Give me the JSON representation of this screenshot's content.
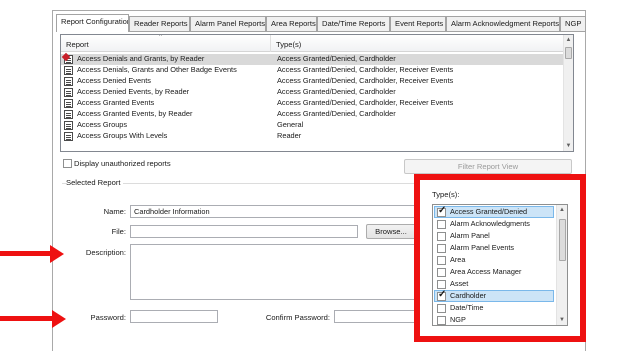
{
  "tabs": [
    "Report Configuration",
    "Reader Reports",
    "Alarm Panel Reports",
    "Area Reports",
    "Date/Time Reports",
    "Event Reports",
    "Alarm Acknowledgment Reports",
    "NGP"
  ],
  "report_list": {
    "columns": [
      "Report",
      "Type(s)"
    ],
    "rows": [
      {
        "name": "Access Denials and Grants, by Reader",
        "type": "Access Granted/Denied, Cardholder",
        "icon": "report-edit-icon"
      },
      {
        "name": "Access Denials, Grants and Other Badge Events",
        "type": "Access Granted/Denied, Cardholder, Receiver Events",
        "icon": "report-icon"
      },
      {
        "name": "Access Denied Events",
        "type": "Access Granted/Denied, Cardholder, Receiver Events",
        "icon": "report-icon"
      },
      {
        "name": "Access Denied Events, by Reader",
        "type": "Access Granted/Denied, Cardholder",
        "icon": "report-icon"
      },
      {
        "name": "Access Granted Events",
        "type": "Access Granted/Denied, Cardholder, Receiver Events",
        "icon": "report-icon"
      },
      {
        "name": "Access Granted Events, by Reader",
        "type": "Access Granted/Denied, Cardholder",
        "icon": "report-icon"
      },
      {
        "name": "Access Groups",
        "type": "General",
        "icon": "report-icon"
      },
      {
        "name": "Access Groups With Levels",
        "type": "Reader",
        "icon": "report-icon"
      }
    ]
  },
  "display_unauthorized_label": "Display unauthorized reports",
  "filter_button_label": "Filter Report View",
  "selected_report_label": "Selected Report",
  "form": {
    "name_label": "Name:",
    "name_value": "Cardholder Information",
    "file_label": "File:",
    "file_value": "",
    "browse_label": "Browse...",
    "description_label": "Description:",
    "password_label": "Password:",
    "confirm_password_label": "Confirm Password:"
  },
  "types": {
    "label": "Type(s):",
    "items": [
      {
        "label": "Access Granted/Denied",
        "checked": true
      },
      {
        "label": "Alarm Acknowledgments",
        "checked": false
      },
      {
        "label": "Alarm Panel",
        "checked": false
      },
      {
        "label": "Alarm Panel Events",
        "checked": false
      },
      {
        "label": "Area",
        "checked": false
      },
      {
        "label": "Area Access Manager",
        "checked": false
      },
      {
        "label": "Asset",
        "checked": false
      },
      {
        "label": "Cardholder",
        "checked": true
      },
      {
        "label": "Date/Time",
        "checked": false
      },
      {
        "label": "NGP",
        "checked": false
      }
    ]
  },
  "colors": {
    "highlight": "#ee1111",
    "selection": "#cce4f7"
  }
}
